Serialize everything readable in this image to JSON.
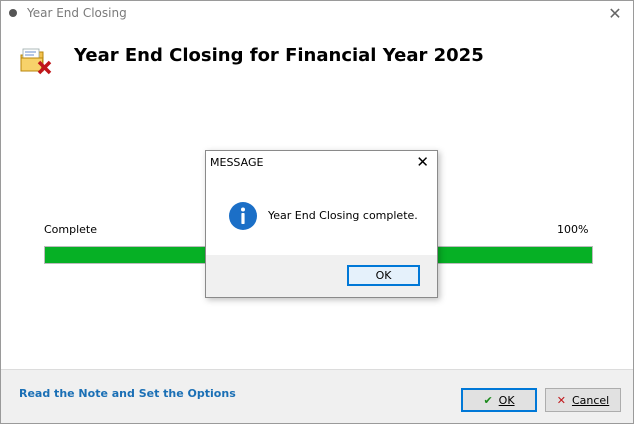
{
  "window": {
    "title": "Year End Closing",
    "close_glyph": "✕"
  },
  "header": {
    "title": "Year End Closing for Financial Year 2025",
    "icon": "folder-close-icon"
  },
  "progress": {
    "status_label": "Complete",
    "percent_label": "100%",
    "value": 1.0,
    "fill_color": "#06b025"
  },
  "footer": {
    "note_link": "Read the Note and Set the Options",
    "ok_label": "OK",
    "cancel_label": "Cancel"
  },
  "message": {
    "title": "MESSAGE",
    "close_glyph": "✕",
    "text": "Year End Closing complete.",
    "icon": "info-icon",
    "ok_label": "OK"
  },
  "colors": {
    "accent": "#0078d7",
    "link": "#1a6fb5",
    "progress": "#06b025"
  }
}
